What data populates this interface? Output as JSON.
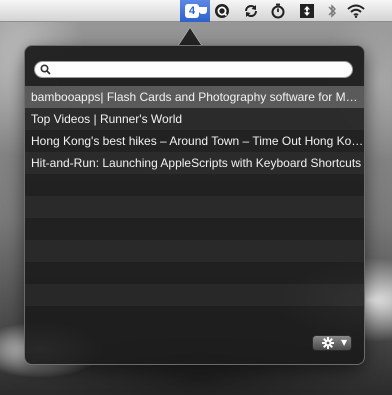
{
  "menubar": {
    "tab_count": "4",
    "icons": [
      "cup-icon",
      "quicksilver-icon",
      "sync-icon",
      "timer-icon",
      "split-icon",
      "bluetooth-icon",
      "wifi-icon"
    ]
  },
  "popover": {
    "search": {
      "value": "",
      "placeholder": ""
    },
    "items": [
      {
        "title": "bambooapps| Flash Cards and Photography software for Mac and iPhone",
        "selected": true
      },
      {
        "title": "Top Videos | Runner's World",
        "selected": false
      },
      {
        "title": "Hong Kong's best hikes – Around Town – Time Out Hong Kong",
        "selected": false
      },
      {
        "title": "Hit-and-Run: Launching AppleScripts with Keyboard Shortcuts",
        "selected": false
      }
    ],
    "empty_rows": 7,
    "settings_icon": "gear-icon"
  },
  "colors": {
    "selection_blue": "#2f62cc",
    "popover_bg": "#1c1c1c",
    "selected_row": "#5a5a5a"
  }
}
